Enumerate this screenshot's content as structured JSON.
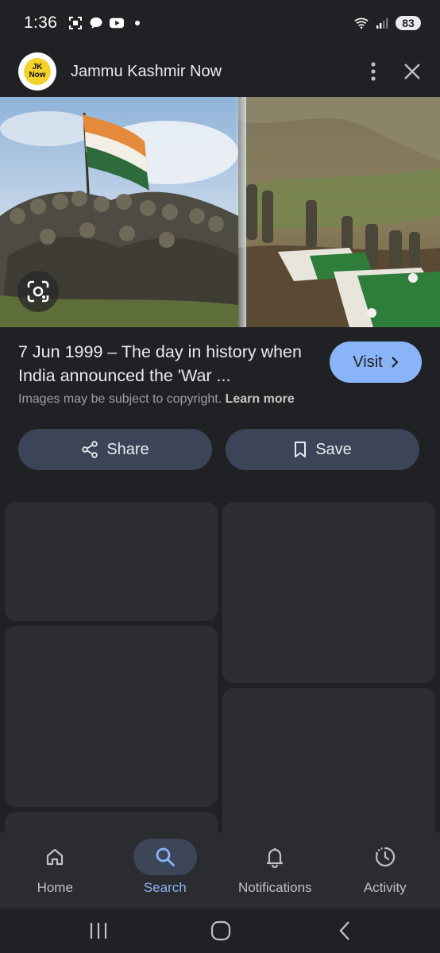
{
  "status_bar": {
    "time": "1:36",
    "battery": "83"
  },
  "header": {
    "logo_line1": "JK",
    "logo_line2": "Now",
    "title": "Jammu Kashmir Now"
  },
  "result": {
    "caption": "7 Jun 1999 – The day in history when India announced the 'War ...",
    "visit_label": "Visit",
    "copyright_text": "Images may be subject to copyright.",
    "learn_more": "Learn more"
  },
  "actions": {
    "share_label": "Share",
    "save_label": "Save"
  },
  "bottom_nav": {
    "items": [
      {
        "label": "Home",
        "icon": "home-icon",
        "active": false
      },
      {
        "label": "Search",
        "icon": "search-icon",
        "active": true
      },
      {
        "label": "Notifications",
        "icon": "bell-icon",
        "active": false
      },
      {
        "label": "Activity",
        "icon": "activity-icon",
        "active": false
      }
    ]
  },
  "colors": {
    "background": "#202124",
    "accent": "#8ab4f8",
    "button_bg": "#3c4557"
  }
}
